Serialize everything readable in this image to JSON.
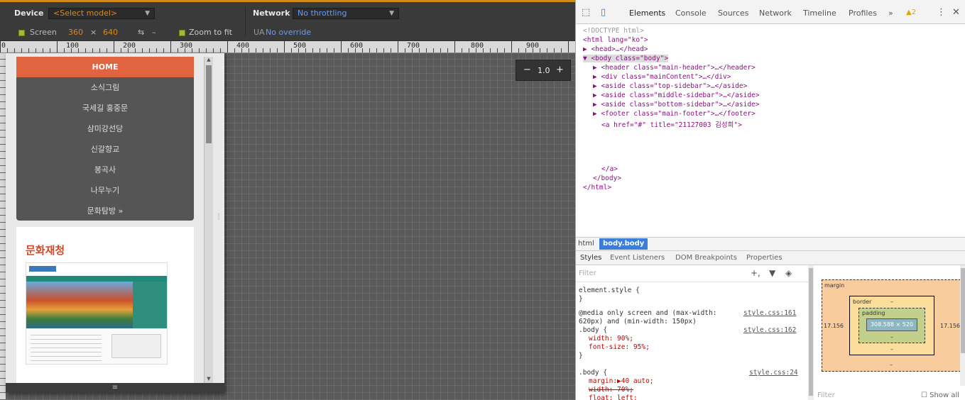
{
  "emulation": {
    "device_label": "Device",
    "device_select": "<Select model>",
    "network_label": "Network",
    "network_select": "No throttling",
    "screen_label": "Screen",
    "screen_width": "360",
    "screen_x": "×",
    "screen_height": "640",
    "swap_icon": "⇆",
    "dash": "–",
    "zoom_fit_label": "Zoom to fit",
    "ua_label": "UA",
    "ua_value": "No override",
    "zoom_minus": "−",
    "zoom_value": "1.0",
    "zoom_plus": "+",
    "ruler_labels": [
      "0",
      "100",
      "200",
      "300",
      "400",
      "500",
      "600",
      "700",
      "800",
      "900"
    ],
    "resize_handle": "‖",
    "bottom_handle": "≡"
  },
  "page": {
    "nav_items": [
      {
        "label": "HOME",
        "active": true
      },
      {
        "label": "소식그림"
      },
      {
        "label": "국세길 홍중문"
      },
      {
        "label": "삼미강선당"
      },
      {
        "label": "신갈향교"
      },
      {
        "label": "봉곡사"
      },
      {
        "label": "나무누기"
      },
      {
        "label": "문화탐방 »"
      }
    ],
    "card_title": "문화재청"
  },
  "devtools": {
    "tabs": [
      "Elements",
      "Console",
      "Sources",
      "Network",
      "Timeline",
      "Profiles"
    ],
    "more": "»",
    "warning_count": "▲2",
    "menu": "⋮",
    "close": "✕",
    "inspect_icon": "⬚",
    "device_icon": "▯",
    "dom": [
      "<!DOCTYPE html>",
      "<html lang=\"ko\">",
      "▶ <head>…</head>",
      "▼ <body class=\"body\">",
      "▶ <header class=\"main-header\">…</header>",
      "▶ <div class=\"mainContent\">…</div>",
      "▶ <aside class=\"top-sidebar\">…</aside>",
      "▶ <aside class=\"middle-sidebar\">…</aside>",
      "▶ <aside class=\"bottom-sidebar\">…</aside>",
      "▶ <footer class=\"main-footer\">…</footer>",
      "<a href=\"#\" title=\"21127003 김성희\">",
      "</a>",
      "</body>",
      "</html>"
    ],
    "breadcrumb": [
      "html",
      "body.body"
    ],
    "subtabs": [
      "Styles",
      "Event Listeners",
      "DOM Breakpoints",
      "Properties"
    ],
    "styles_filter": "Filter",
    "styles_icons": [
      "+,",
      "▼",
      "◈"
    ],
    "styles": [
      {
        "text": "element.style {",
        "link": ""
      },
      {
        "text": "}",
        "link": ""
      },
      {
        "text": "@media only screen and (max-width:",
        "link": "style.css:161"
      },
      {
        "text": "620px) and (min-width: 150px)",
        "link": ""
      },
      {
        "text": ".body {",
        "link": "style.css:162"
      },
      {
        "text": "width: 90%;",
        "link": "",
        "prop": true
      },
      {
        "text": "font-size: 95%;",
        "link": "",
        "prop": true
      },
      {
        "text": "}",
        "link": ""
      },
      {
        "text": ".body {",
        "link": "style.css:24"
      },
      {
        "text": "margin:▶40 auto;",
        "link": "",
        "prop": true
      },
      {
        "text": "width: 70%;",
        "link": "",
        "strike": true
      },
      {
        "text": "float: left;",
        "link": "",
        "prop": true
      }
    ],
    "boxmodel": {
      "margin_label": "margin",
      "border_label": "border",
      "padding_label": "padding",
      "content": "308.588 × 520",
      "side_left": "17.156",
      "side_right": "17.156",
      "dash": "–",
      "filter": "Filter",
      "show_all": "Show all"
    }
  }
}
